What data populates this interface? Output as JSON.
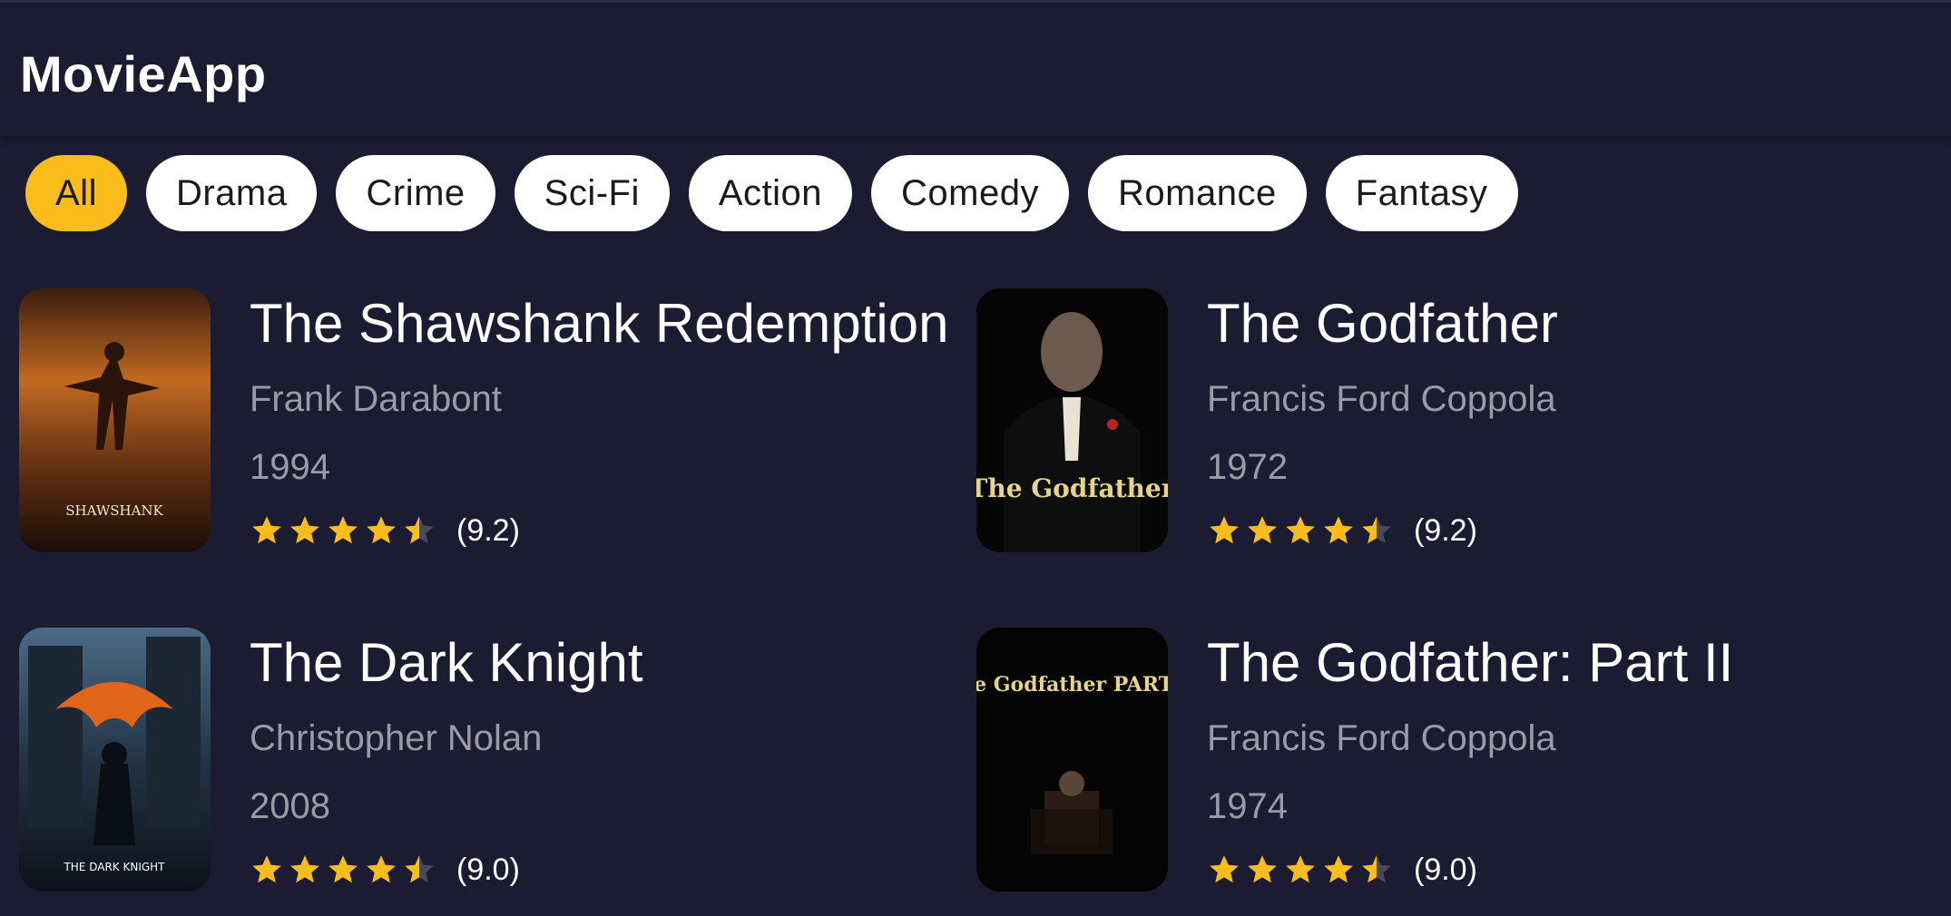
{
  "app": {
    "title": "MovieApp"
  },
  "colors": {
    "background": "#1b1b32",
    "accent": "#fbbd1c",
    "chip_bg": "#ffffff",
    "secondary_text": "#9b9ba7"
  },
  "categories": [
    {
      "label": "All",
      "selected": true
    },
    {
      "label": "Drama",
      "selected": false
    },
    {
      "label": "Crime",
      "selected": false
    },
    {
      "label": "Sci-Fi",
      "selected": false
    },
    {
      "label": "Action",
      "selected": false
    },
    {
      "label": "Comedy",
      "selected": false
    },
    {
      "label": "Romance",
      "selected": false
    },
    {
      "label": "Fantasy",
      "selected": false
    }
  ],
  "movies": [
    {
      "title": "The Shawshank Redemption",
      "director": "Frank Darabont",
      "year": "1994",
      "rating_label": "(9.2)",
      "stars": 4.5,
      "poster_text": "SHAWSHANK"
    },
    {
      "title": "The Godfather",
      "director": "Francis Ford Coppola",
      "year": "1972",
      "rating_label": "(9.2)",
      "stars": 4.5,
      "poster_text": "The Godfather"
    },
    {
      "title": "The Dark Knight",
      "director": "Christopher Nolan",
      "year": "2008",
      "rating_label": "(9.0)",
      "stars": 4.5,
      "poster_text": "THE DARK KNIGHT"
    },
    {
      "title": "The Godfather: Part II",
      "director": "Francis Ford Coppola",
      "year": "1974",
      "rating_label": "(9.0)",
      "stars": 4.5,
      "poster_text": "The Godfather PART II"
    }
  ]
}
